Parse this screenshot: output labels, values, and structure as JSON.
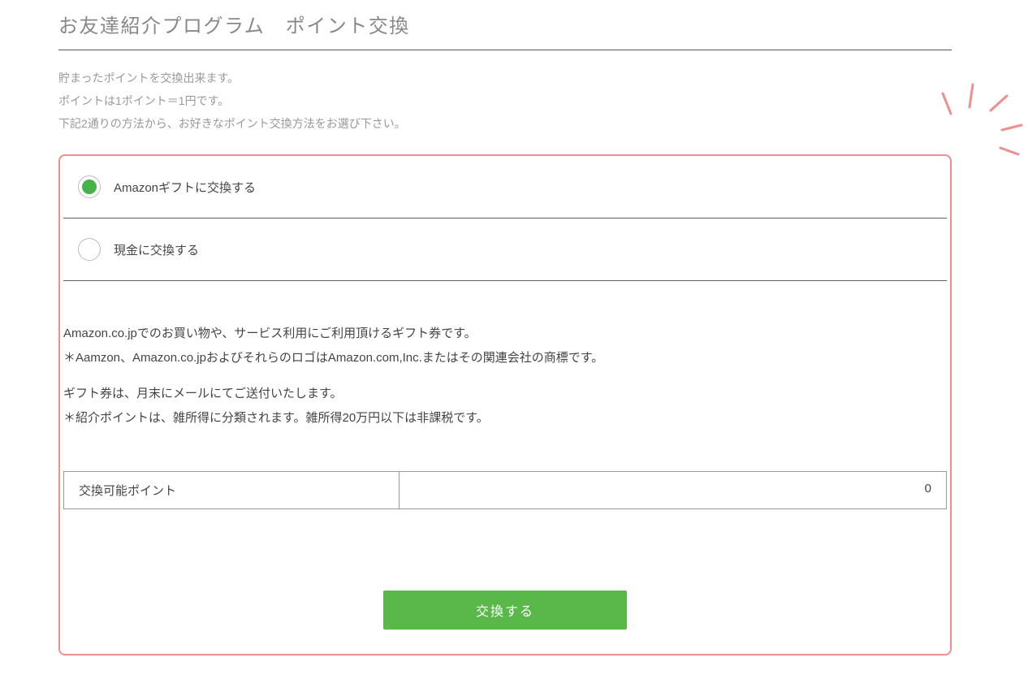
{
  "page": {
    "title": "お友達紹介プログラム　ポイント交換"
  },
  "intro": {
    "line1": "貯まったポイントを交換出来ます。",
    "line2": "ポイントは1ポイント＝1円です。",
    "line3": "下記2通りの方法から、お好きなポイント交換方法をお選び下さい。"
  },
  "options": {
    "amazon": "Amazonギフトに交換する",
    "cash": "現金に交換する"
  },
  "desc": {
    "line1": "Amazon.co.jpでのお買い物や、サービス利用にご利用頂けるギフト券です。",
    "line2": "＊Aamzon、Amazon.co.jpおよびそれらのロゴはAmazon.com,Inc.またはその関連会社の商標です。",
    "line3": "ギフト券は、月末にメールにてご送付いたします。",
    "line4": "＊紹介ポイントは、雑所得に分類されます。雑所得20万円以下は非課税です。"
  },
  "points": {
    "label": "交換可能ポイント",
    "value": "0"
  },
  "button": {
    "exchange": "交換する"
  }
}
